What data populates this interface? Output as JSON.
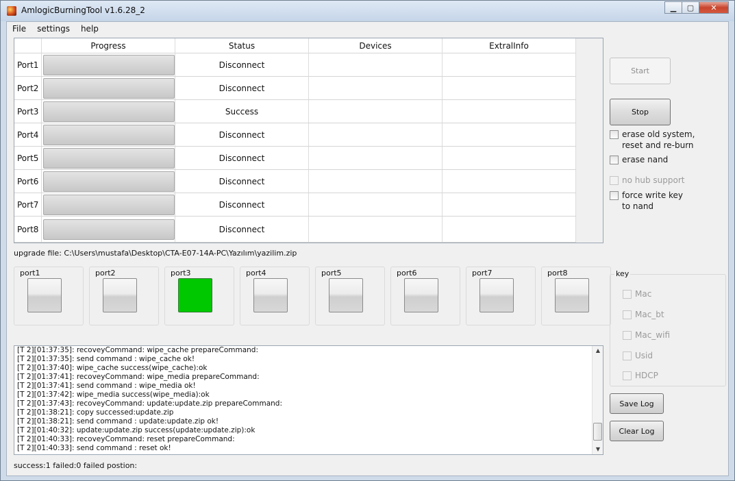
{
  "window": {
    "title": "AmlogicBurningTool  v1.6.28_2",
    "minimize": "▁",
    "maximize": "▢",
    "close": "✕"
  },
  "menu": [
    "File",
    "settings",
    "help"
  ],
  "table": {
    "headers": [
      "",
      "Progress",
      "Status",
      "Devices",
      "ExtralInfo"
    ],
    "rows": [
      {
        "port": "Port1",
        "status": "Disconnect",
        "devices": "",
        "info": ""
      },
      {
        "port": "Port2",
        "status": "Disconnect",
        "devices": "",
        "info": ""
      },
      {
        "port": "Port3",
        "status": "Success",
        "devices": "",
        "info": ""
      },
      {
        "port": "Port4",
        "status": "Disconnect",
        "devices": "",
        "info": ""
      },
      {
        "port": "Port5",
        "status": "Disconnect",
        "devices": "",
        "info": ""
      },
      {
        "port": "Port6",
        "status": "Disconnect",
        "devices": "",
        "info": ""
      },
      {
        "port": "Port7",
        "status": "Disconnect",
        "devices": "",
        "info": ""
      },
      {
        "port": "Port8",
        "status": "Disconnect",
        "devices": "",
        "info": ""
      }
    ]
  },
  "upgrade_file": "upgrade file: C:\\Users\\mustafa\\Desktop\\CTA-E07-14A-PC\\Yazılım\\yazilim.zip",
  "ports": [
    {
      "label": "port1",
      "state": "idle"
    },
    {
      "label": "port2",
      "state": "idle"
    },
    {
      "label": "port3",
      "state": "success"
    },
    {
      "label": "port4",
      "state": "idle"
    },
    {
      "label": "port5",
      "state": "idle"
    },
    {
      "label": "port6",
      "state": "idle"
    },
    {
      "label": "port7",
      "state": "idle"
    },
    {
      "label": "port8",
      "state": "idle"
    }
  ],
  "log": [
    "[T 2][01:37:35]: recoveyCommand:  wipe_cache prepareCommand:",
    "[T 2][01:37:35]: send command : wipe_cache ok!",
    "[T 2][01:37:40]: wipe_cache success(wipe_cache):ok",
    "[T 2][01:37:41]: recoveyCommand:  wipe_media prepareCommand:",
    "[T 2][01:37:41]: send command : wipe_media ok!",
    "[T 2][01:37:42]: wipe_media success(wipe_media):ok",
    "[T 2][01:37:43]: recoveyCommand:  update:update.zip prepareCommand:",
    "[T 2][01:38:21]: copy successed:update.zip",
    "[T 2][01:38:21]: send command : update:update.zip ok!",
    "[T 2][01:40:32]: update:update.zip success(update:update.zip):ok",
    "[T 2][01:40:33]: recoveyCommand:  reset prepareCommand:",
    "[T 2][01:40:33]: send command : reset ok!"
  ],
  "log_scroll": {
    "up": "▲",
    "down": "▼"
  },
  "summary": "success:1 failed:0 failed postion:",
  "buttons": {
    "start": "Start",
    "stop": "Stop",
    "save_log": "Save Log",
    "clear_log": "Clear Log"
  },
  "options": {
    "erase_old": "erase old system,\nreset and re-burn",
    "erase_nand": "erase nand",
    "no_hub": "no hub support",
    "force_write": "force write key\nto nand"
  },
  "key_group": {
    "title": "key",
    "items": [
      "Mac",
      "Mac_bt",
      "Mac_wifi",
      "Usid",
      "HDCP"
    ]
  },
  "colors": {
    "success": "#00c800"
  }
}
